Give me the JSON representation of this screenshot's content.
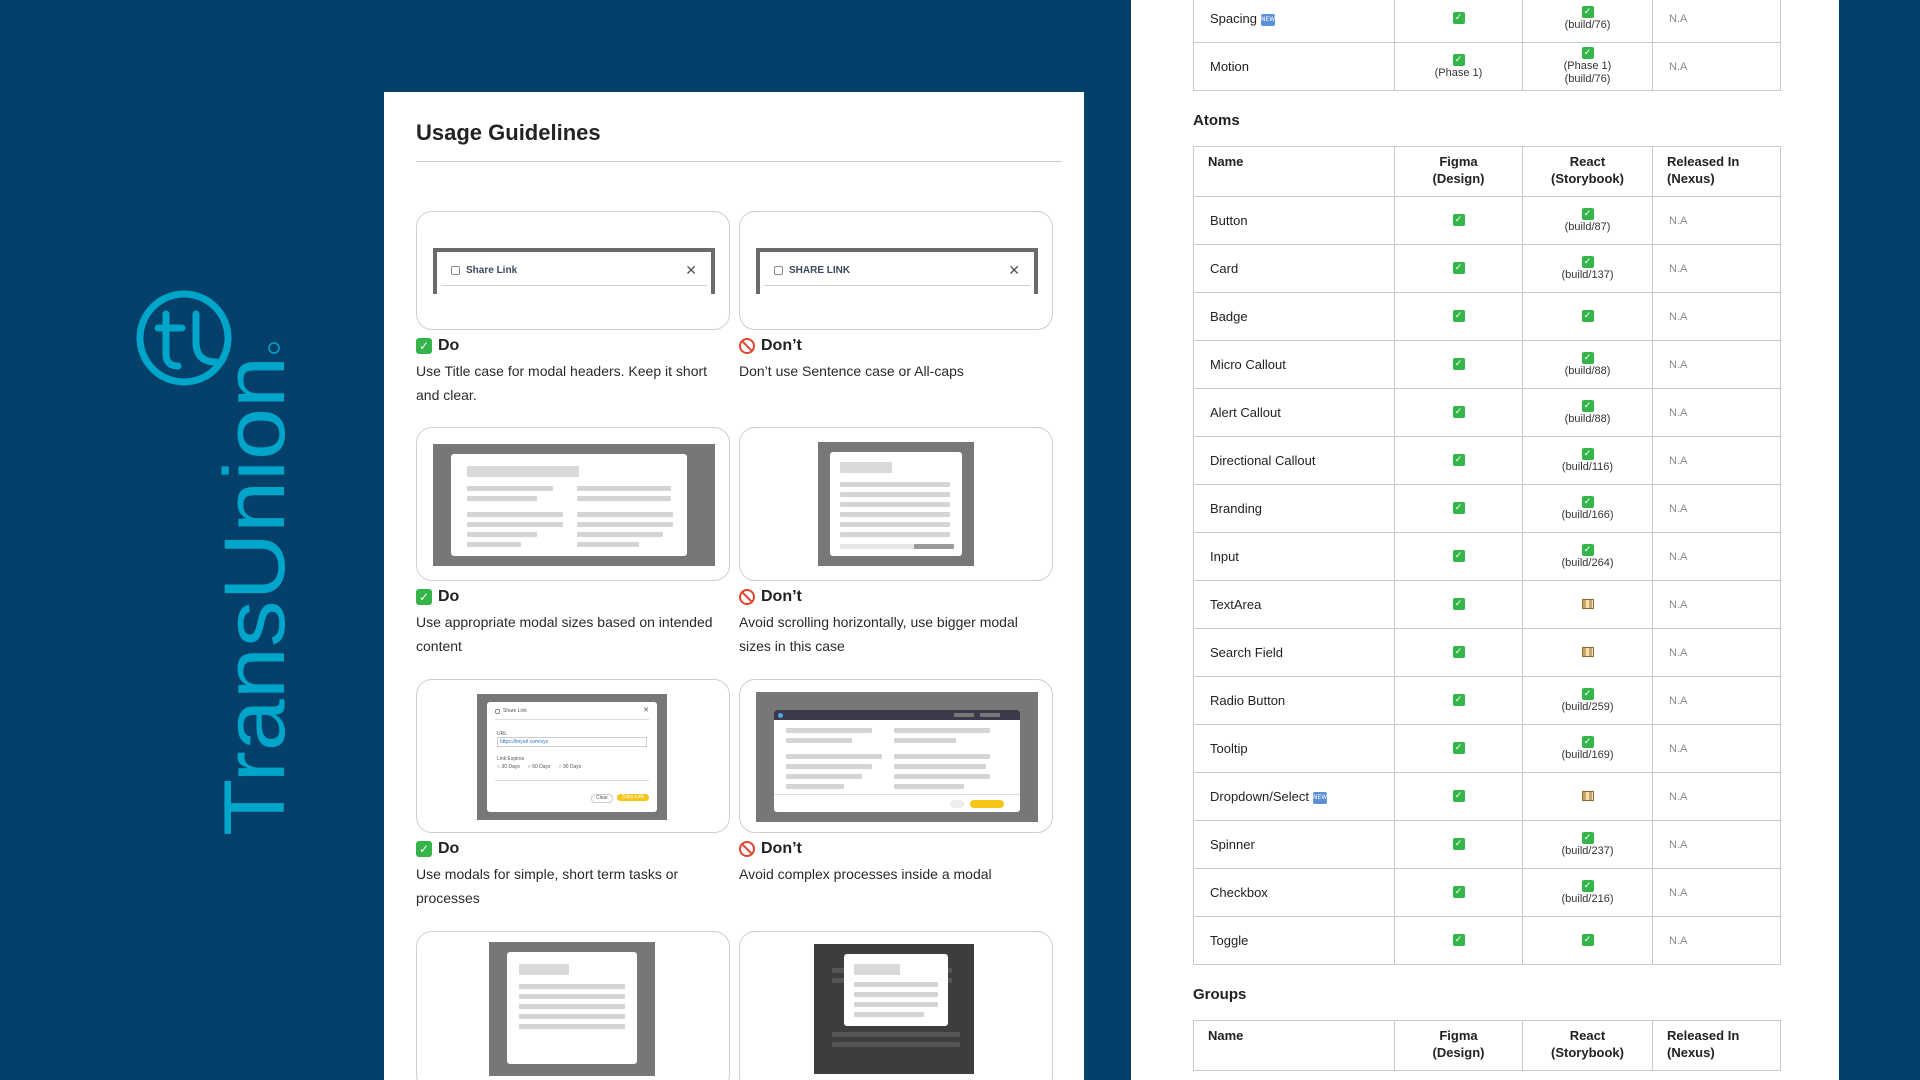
{
  "brand": {
    "name": "TransUnion",
    "color": "#00a6ca",
    "background": "#05406a"
  },
  "guidelines": {
    "title": "Usage Guidelines",
    "items": [
      {
        "verdict": "Do",
        "text": "Use Title case for modal headers. Keep it short and clear.",
        "preview_label": "Share Link"
      },
      {
        "verdict": "Don’t",
        "text": "Don’t use Sentence case or All-caps",
        "preview_label": "SHARE LINK"
      },
      {
        "verdict": "Do",
        "text": "Use appropriate modal sizes based on intended content"
      },
      {
        "verdict": "Don’t",
        "text": "Avoid scrolling horizontally, use bigger modal sizes in this case"
      },
      {
        "verdict": "Do",
        "text": "Use modals for simple, short term tasks or processes",
        "preview": {
          "title": "Share Link",
          "url_label": "URL",
          "url": "https://tinyurl.com/xyz",
          "expires_label": "Link Expires",
          "options": [
            "30 Days",
            "60 Days",
            "90 Days"
          ],
          "clear": "Clear",
          "copy": "Copy Link"
        }
      },
      {
        "verdict": "Don’t",
        "text": "Avoid complex processes inside a modal"
      },
      {
        "verdict": "",
        "text": ""
      },
      {
        "verdict": "",
        "text": ""
      }
    ]
  },
  "status_table": {
    "headers": [
      "Name",
      "Figma\n(Design)",
      "React\n(Storybook)",
      "Released In\n(Nexus)"
    ],
    "foundations_tail": [
      {
        "name": "Spacing",
        "is_new": true,
        "figma": "",
        "react": "(build/76)",
        "nexus": "N.A"
      },
      {
        "name": "Motion",
        "figma": "(Phase 1)",
        "react": "(Phase 1)\n(build/76)",
        "nexus": "N.A"
      }
    ],
    "atoms_title": "Atoms",
    "atoms": [
      {
        "name": "Button",
        "react": "(build/87)",
        "nexus": "N.A"
      },
      {
        "name": "Card",
        "react": "(build/137)",
        "nexus": "N.A"
      },
      {
        "name": "Badge",
        "react": "",
        "nexus": "N.A"
      },
      {
        "name": "Micro Callout",
        "react": "(build/88)",
        "nexus": "N.A"
      },
      {
        "name": "Alert Callout",
        "react": "(build/88)",
        "nexus": "N.A"
      },
      {
        "name": "Directional Callout",
        "react": "(build/116)",
        "nexus": "N.A"
      },
      {
        "name": "Branding",
        "react": "(build/166)",
        "nexus": "N.A"
      },
      {
        "name": "Input",
        "react": "(build/264)",
        "nexus": "N.A"
      },
      {
        "name": "TextArea",
        "react_status": "wip",
        "nexus": "N.A"
      },
      {
        "name": "Search Field",
        "react_status": "wip",
        "nexus": "N.A"
      },
      {
        "name": "Radio Button",
        "react": "(build/259)",
        "nexus": "N.A"
      },
      {
        "name": "Tooltip",
        "react": "(build/169)",
        "nexus": "N.A"
      },
      {
        "name": "Dropdown/Select",
        "is_new": true,
        "react_status": "wip",
        "nexus": "N.A"
      },
      {
        "name": "Spinner",
        "react": "(build/237)",
        "nexus": "N.A"
      },
      {
        "name": "Checkbox",
        "react": "(build/216)",
        "nexus": "N.A"
      },
      {
        "name": "Toggle",
        "react": "",
        "nexus": "N.A"
      }
    ],
    "groups_title": "Groups",
    "groups_headers": {
      "name": "Name",
      "figma_1": "Figma",
      "figma_2": "(Design)",
      "react_1": "React",
      "react_2": "(Storybook)",
      "nexus_1": "Released In",
      "nexus_2": "(Nexus)"
    }
  }
}
